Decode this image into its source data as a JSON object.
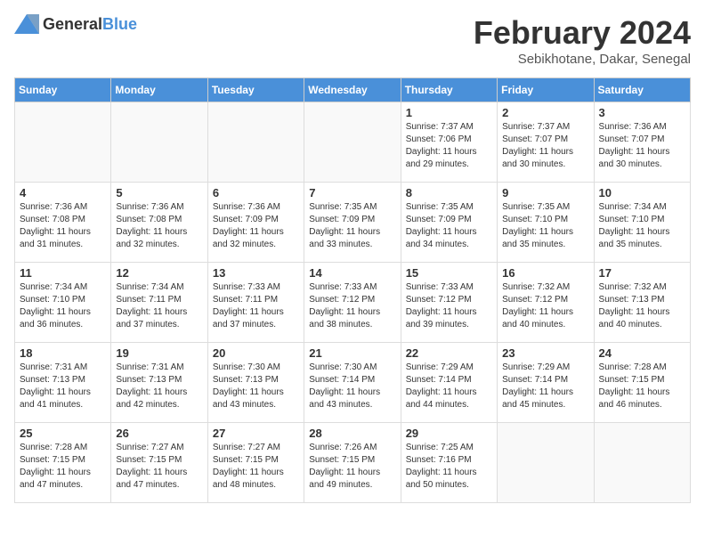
{
  "header": {
    "logo_general": "General",
    "logo_blue": "Blue",
    "month": "February 2024",
    "location": "Sebikhotane, Dakar, Senegal"
  },
  "weekdays": [
    "Sunday",
    "Monday",
    "Tuesday",
    "Wednesday",
    "Thursday",
    "Friday",
    "Saturday"
  ],
  "weeks": [
    [
      {
        "day": "",
        "info": ""
      },
      {
        "day": "",
        "info": ""
      },
      {
        "day": "",
        "info": ""
      },
      {
        "day": "",
        "info": ""
      },
      {
        "day": "1",
        "info": "Sunrise: 7:37 AM\nSunset: 7:06 PM\nDaylight: 11 hours\nand 29 minutes."
      },
      {
        "day": "2",
        "info": "Sunrise: 7:37 AM\nSunset: 7:07 PM\nDaylight: 11 hours\nand 30 minutes."
      },
      {
        "day": "3",
        "info": "Sunrise: 7:36 AM\nSunset: 7:07 PM\nDaylight: 11 hours\nand 30 minutes."
      }
    ],
    [
      {
        "day": "4",
        "info": "Sunrise: 7:36 AM\nSunset: 7:08 PM\nDaylight: 11 hours\nand 31 minutes."
      },
      {
        "day": "5",
        "info": "Sunrise: 7:36 AM\nSunset: 7:08 PM\nDaylight: 11 hours\nand 32 minutes."
      },
      {
        "day": "6",
        "info": "Sunrise: 7:36 AM\nSunset: 7:09 PM\nDaylight: 11 hours\nand 32 minutes."
      },
      {
        "day": "7",
        "info": "Sunrise: 7:35 AM\nSunset: 7:09 PM\nDaylight: 11 hours\nand 33 minutes."
      },
      {
        "day": "8",
        "info": "Sunrise: 7:35 AM\nSunset: 7:09 PM\nDaylight: 11 hours\nand 34 minutes."
      },
      {
        "day": "9",
        "info": "Sunrise: 7:35 AM\nSunset: 7:10 PM\nDaylight: 11 hours\nand 35 minutes."
      },
      {
        "day": "10",
        "info": "Sunrise: 7:34 AM\nSunset: 7:10 PM\nDaylight: 11 hours\nand 35 minutes."
      }
    ],
    [
      {
        "day": "11",
        "info": "Sunrise: 7:34 AM\nSunset: 7:10 PM\nDaylight: 11 hours\nand 36 minutes."
      },
      {
        "day": "12",
        "info": "Sunrise: 7:34 AM\nSunset: 7:11 PM\nDaylight: 11 hours\nand 37 minutes."
      },
      {
        "day": "13",
        "info": "Sunrise: 7:33 AM\nSunset: 7:11 PM\nDaylight: 11 hours\nand 37 minutes."
      },
      {
        "day": "14",
        "info": "Sunrise: 7:33 AM\nSunset: 7:12 PM\nDaylight: 11 hours\nand 38 minutes."
      },
      {
        "day": "15",
        "info": "Sunrise: 7:33 AM\nSunset: 7:12 PM\nDaylight: 11 hours\nand 39 minutes."
      },
      {
        "day": "16",
        "info": "Sunrise: 7:32 AM\nSunset: 7:12 PM\nDaylight: 11 hours\nand 40 minutes."
      },
      {
        "day": "17",
        "info": "Sunrise: 7:32 AM\nSunset: 7:13 PM\nDaylight: 11 hours\nand 40 minutes."
      }
    ],
    [
      {
        "day": "18",
        "info": "Sunrise: 7:31 AM\nSunset: 7:13 PM\nDaylight: 11 hours\nand 41 minutes."
      },
      {
        "day": "19",
        "info": "Sunrise: 7:31 AM\nSunset: 7:13 PM\nDaylight: 11 hours\nand 42 minutes."
      },
      {
        "day": "20",
        "info": "Sunrise: 7:30 AM\nSunset: 7:13 PM\nDaylight: 11 hours\nand 43 minutes."
      },
      {
        "day": "21",
        "info": "Sunrise: 7:30 AM\nSunset: 7:14 PM\nDaylight: 11 hours\nand 43 minutes."
      },
      {
        "day": "22",
        "info": "Sunrise: 7:29 AM\nSunset: 7:14 PM\nDaylight: 11 hours\nand 44 minutes."
      },
      {
        "day": "23",
        "info": "Sunrise: 7:29 AM\nSunset: 7:14 PM\nDaylight: 11 hours\nand 45 minutes."
      },
      {
        "day": "24",
        "info": "Sunrise: 7:28 AM\nSunset: 7:15 PM\nDaylight: 11 hours\nand 46 minutes."
      }
    ],
    [
      {
        "day": "25",
        "info": "Sunrise: 7:28 AM\nSunset: 7:15 PM\nDaylight: 11 hours\nand 47 minutes."
      },
      {
        "day": "26",
        "info": "Sunrise: 7:27 AM\nSunset: 7:15 PM\nDaylight: 11 hours\nand 47 minutes."
      },
      {
        "day": "27",
        "info": "Sunrise: 7:27 AM\nSunset: 7:15 PM\nDaylight: 11 hours\nand 48 minutes."
      },
      {
        "day": "28",
        "info": "Sunrise: 7:26 AM\nSunset: 7:15 PM\nDaylight: 11 hours\nand 49 minutes."
      },
      {
        "day": "29",
        "info": "Sunrise: 7:25 AM\nSunset: 7:16 PM\nDaylight: 11 hours\nand 50 minutes."
      },
      {
        "day": "",
        "info": ""
      },
      {
        "day": "",
        "info": ""
      }
    ]
  ]
}
